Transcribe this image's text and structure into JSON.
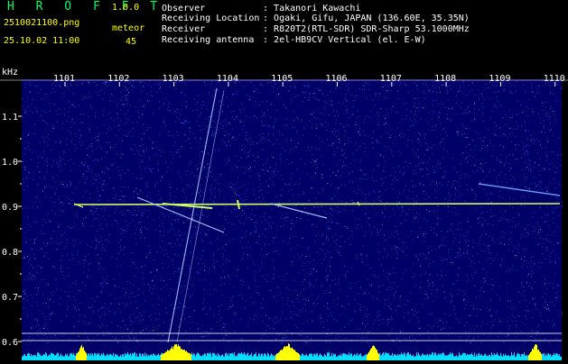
{
  "app": {
    "title": "H R O F F T",
    "version": "1.0.0",
    "filename": "2510021100.png",
    "datetime": "25.10.02 11:00"
  },
  "meteor": {
    "label": "meteor",
    "count": "45"
  },
  "info": [
    {
      "label": "Observer",
      "value": "Takanori Kawachi"
    },
    {
      "label": "Receiving Location",
      "value": "Ogaki, Gifu, JAPAN (136.60E, 35.35N)"
    },
    {
      "label": "Receiver",
      "value": "R820T2(RTL-SDR) SDR-Sharp 53.1000MHz"
    },
    {
      "label": "Receiving antenna",
      "value": "2el-HB9CV Vertical (el. E-W)"
    }
  ],
  "waterfall": {
    "unit": "kHz",
    "x_ticks": [
      "1101",
      "1102",
      "1103",
      "1104",
      "1105",
      "1106",
      "1107",
      "1108",
      "1109",
      "1110"
    ],
    "y_ticks": [
      "1.1",
      "1.0",
      "0.9",
      "0.8",
      "0.7",
      "0.6"
    ],
    "colors": {
      "background": "#000066",
      "noise": "#3355ff",
      "carrier": "#ccff66",
      "trail": "#aaccff",
      "spectrum": "#00ddff",
      "spectrum_peak": "#ffff00",
      "grid": "#ffffff",
      "axis_text": "#ffffff"
    }
  }
}
